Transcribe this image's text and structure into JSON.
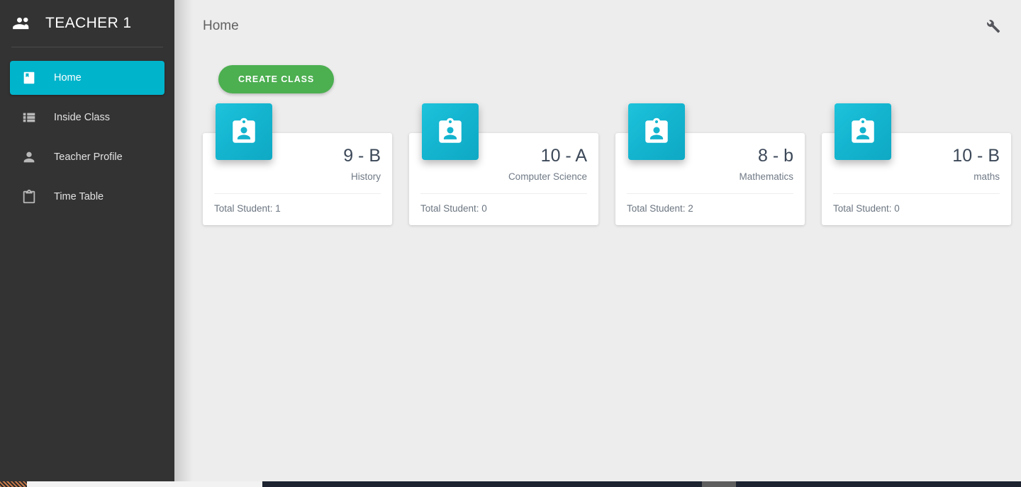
{
  "sidebar": {
    "brand": {
      "icon": "people-icon",
      "title": "TEACHER 1"
    },
    "items": [
      {
        "icon": "book-icon",
        "label": "Home",
        "active": true
      },
      {
        "icon": "list-icon",
        "label": "Inside Class",
        "active": false
      },
      {
        "icon": "person-icon",
        "label": "Teacher Profile",
        "active": false
      },
      {
        "icon": "clipboard-icon",
        "label": "Time Table",
        "active": false
      }
    ]
  },
  "topbar": {
    "title": "Home",
    "tool_icon": "wrench-icon"
  },
  "actions": {
    "create_class_label": "CREATE CLASS"
  },
  "cards": [
    {
      "icon": "badge-person-icon",
      "name": "9 - B",
      "subject": "History",
      "students": "Total Student: 1"
    },
    {
      "icon": "badge-person-icon",
      "name": "10 - A",
      "subject": "Computer Science",
      "students": "Total Student: 0"
    },
    {
      "icon": "badge-person-icon",
      "name": "8 - b",
      "subject": "Mathematics",
      "students": "Total Student: 2"
    },
    {
      "icon": "badge-person-icon",
      "name": "10 - B",
      "subject": "maths",
      "students": "Total Student: 0"
    }
  ],
  "colors": {
    "sidebar_bg": "#333333",
    "accent_teal": "#00b4cc",
    "badge_teal": "#14b5d0",
    "create_green": "#4caf50",
    "content_bg": "#ededed",
    "card_bg": "#ffffff",
    "title_text": "#3c4858"
  }
}
